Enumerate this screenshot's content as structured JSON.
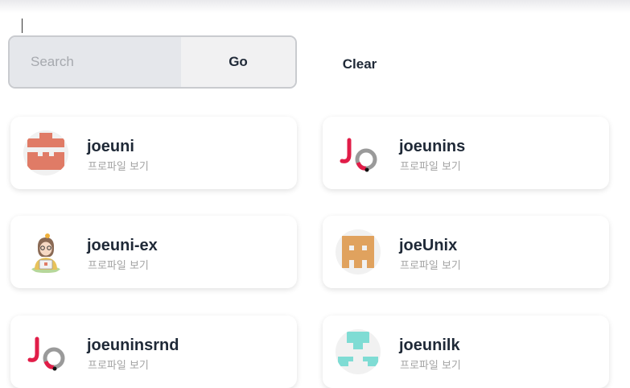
{
  "search": {
    "placeholder": "Search",
    "value": "",
    "go_label": "Go",
    "clear_label": "Clear"
  },
  "results": [
    {
      "username": "joeuni",
      "link": "프로파일 보기",
      "avatar": "identicon-coral-avatar"
    },
    {
      "username": "joeunins",
      "link": "프로파일 보기",
      "avatar": "jo-logo-avatar"
    },
    {
      "username": "joeuni-ex",
      "link": "프로파일 보기",
      "avatar": "illustrated-person-avatar"
    },
    {
      "username": "joeUnix",
      "link": "프로파일 보기",
      "avatar": "identicon-orange-avatar"
    },
    {
      "username": "joeuninsrnd",
      "link": "프로파일 보기",
      "avatar": "jo-logo-avatar"
    },
    {
      "username": "joeunilk",
      "link": "프로파일 보기",
      "avatar": "identicon-teal-avatar"
    }
  ],
  "colors": {
    "coral_identicon": "#e07b66",
    "orange_identicon": "#e0a25e",
    "teal_identicon": "#7fdcd4",
    "logo_red": "#e11d48",
    "logo_gray": "#9a9a9a",
    "text_dark": "#1f2937",
    "text_muted": "#a3a3a3"
  }
}
